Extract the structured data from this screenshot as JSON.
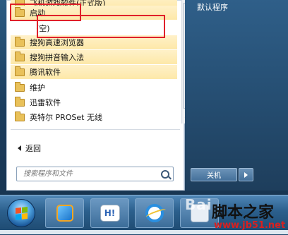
{
  "start_menu": {
    "programs": [
      {
        "label": "飞机游戏软件(正式版)"
      },
      {
        "label": "启动"
      },
      {
        "label": "(空)"
      },
      {
        "label": "搜狗高速浏览器"
      },
      {
        "label": "搜狗拼音输入法"
      },
      {
        "label": "腾讯软件"
      },
      {
        "label": "维护"
      },
      {
        "label": "迅雷软件"
      },
      {
        "label": "英特尔 PROSet 无线"
      }
    ],
    "back_label": "返回",
    "search_placeholder": "搜索程序和文件",
    "right_pane": {
      "default_programs": "默认程序",
      "shutdown_label": "关机"
    }
  },
  "taskbar": {
    "app_2_label": "H!"
  },
  "watermark": {
    "baidu": "Bai",
    "site_name": "脚本之家",
    "url": "www.jb51.net"
  },
  "colors": {
    "highlight": "#fdeaa8",
    "annotation_red": "#e0202a"
  }
}
